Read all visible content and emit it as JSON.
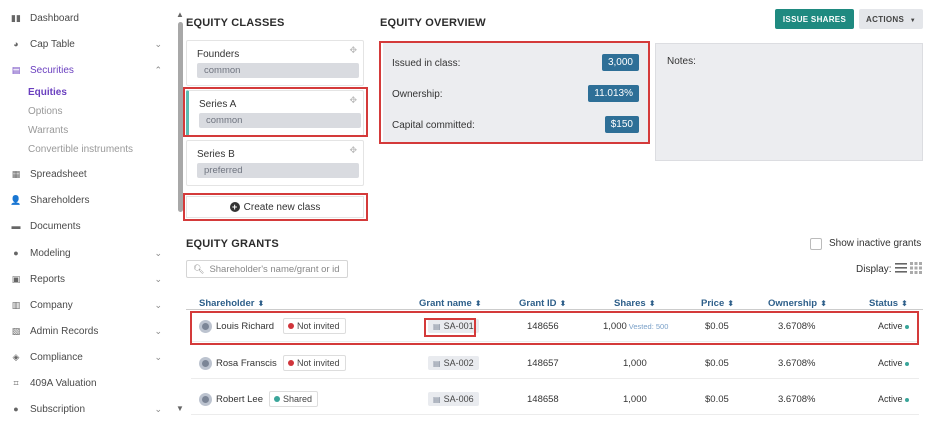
{
  "sidebar": {
    "items": [
      {
        "label": "Dashboard",
        "icon": "dashboard-icon",
        "has_chevron": false
      },
      {
        "label": "Cap Table",
        "icon": "pie-chart-icon",
        "has_chevron": true
      },
      {
        "label": "Securities",
        "icon": "clipboard-icon",
        "has_chevron": true,
        "expanded": true
      },
      {
        "label": "Spreadsheet",
        "icon": "table-icon",
        "has_chevron": false
      },
      {
        "label": "Shareholders",
        "icon": "user-icon",
        "has_chevron": false
      },
      {
        "label": "Documents",
        "icon": "folder-icon",
        "has_chevron": false
      },
      {
        "label": "Modeling",
        "icon": "lightbulb-icon",
        "has_chevron": true
      },
      {
        "label": "Reports",
        "icon": "report-icon",
        "has_chevron": true
      },
      {
        "label": "Company",
        "icon": "building-icon",
        "has_chevron": true
      },
      {
        "label": "Admin Records",
        "icon": "records-icon",
        "has_chevron": true
      },
      {
        "label": "Compliance",
        "icon": "shield-icon",
        "has_chevron": true
      },
      {
        "label": "409A Valuation",
        "icon": "valuation-icon",
        "has_chevron": false
      },
      {
        "label": "Subscription",
        "icon": "info-icon",
        "has_chevron": true
      }
    ],
    "securities_sub": [
      "Equities",
      "Options",
      "Warrants",
      "Convertible instruments"
    ],
    "active_item": "Securities",
    "active_sub": "Equities"
  },
  "equity_classes": {
    "title": "EQUITY CLASSES",
    "classes": [
      {
        "name": "Founders",
        "type": "common"
      },
      {
        "name": "Series A",
        "type": "common"
      },
      {
        "name": "Series B",
        "type": "preferred"
      }
    ],
    "selected": "Series A",
    "create_label": "Create new class"
  },
  "overview": {
    "title": "EQUITY OVERVIEW",
    "issued_label": "Issued in class:",
    "issued_value": "3,000",
    "ownership_label": "Ownership:",
    "ownership_value": "11.013%",
    "capital_label": "Capital committed:",
    "capital_value": "$150",
    "notes_label": "Notes:"
  },
  "actions": {
    "issue_shares": "ISSUE SHARES",
    "actions_label": "ACTIONS",
    "actions_caret": "▼"
  },
  "grants": {
    "title": "EQUITY GRANTS",
    "show_inactive_label": "Show inactive grants",
    "search_placeholder": "Shareholder's name/grant or id",
    "display_label": "Display:",
    "columns": [
      "Shareholder",
      "Grant name",
      "Grant ID",
      "Shares",
      "Price",
      "Ownership",
      "Status"
    ],
    "rows": [
      {
        "shareholder": "Louis Richard",
        "invite": "Not invited",
        "invite_color": "#d0343b",
        "grant_name": "SA-001",
        "grant_id": "148656",
        "shares": "1,000",
        "vested": "Vested: 500",
        "price": "$0.05",
        "ownership": "3.6708%",
        "status": "Active"
      },
      {
        "shareholder": "Rosa Franscis",
        "invite": "Not invited",
        "invite_color": "#d0343b",
        "grant_name": "SA-002",
        "grant_id": "148657",
        "shares": "1,000",
        "vested": "",
        "price": "$0.05",
        "ownership": "3.6708%",
        "status": "Active"
      },
      {
        "shareholder": "Robert Lee",
        "invite": "Shared",
        "invite_color": "#3aa59a",
        "grant_name": "SA-006",
        "grant_id": "148658",
        "shares": "1,000",
        "vested": "",
        "price": "$0.05",
        "ownership": "3.6708%",
        "status": "Active"
      }
    ]
  },
  "colors": {
    "accent": "#6a3fbf",
    "primary_button": "#1f8a80",
    "pill": "#2e6f97",
    "highlight": "#d43a3a"
  }
}
